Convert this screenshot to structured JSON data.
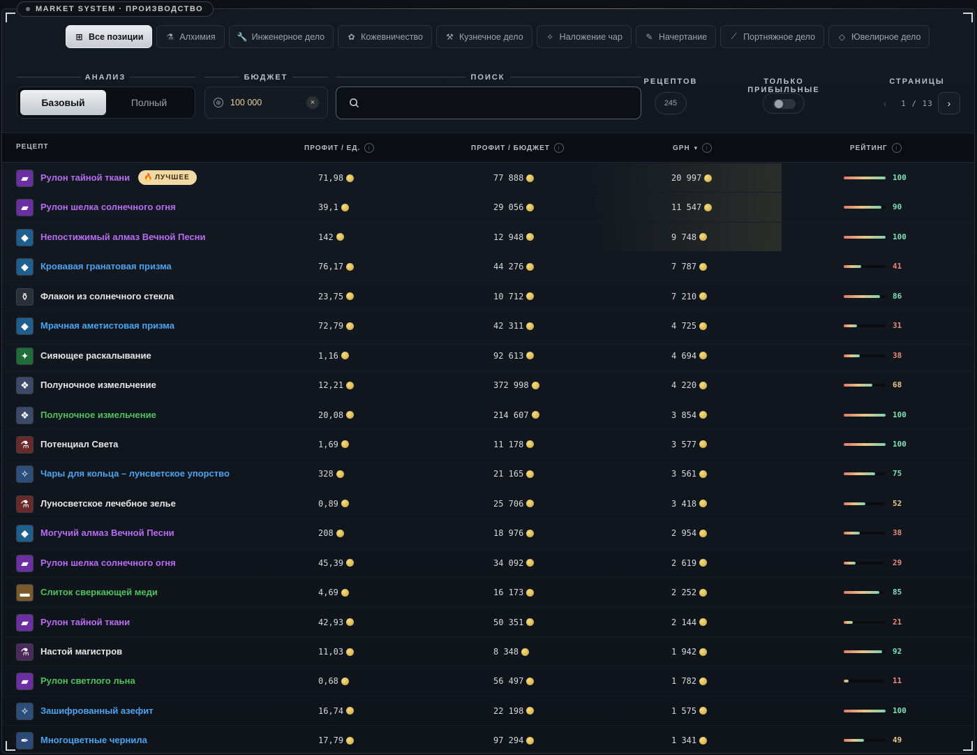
{
  "app": {
    "system_badge": "MARKET SYSTEM · ПРОИЗВОДСТВО"
  },
  "tabs": [
    {
      "label": "Все позиции",
      "icon": "grid-icon",
      "active": true
    },
    {
      "label": "Алхимия",
      "icon": "flask-icon"
    },
    {
      "label": "Инженерное дело",
      "icon": "wrench-icon"
    },
    {
      "label": "Кожевничество",
      "icon": "paw-icon"
    },
    {
      "label": "Кузнечное дело",
      "icon": "hammer-icon"
    },
    {
      "label": "Наложение чар",
      "icon": "sparkle-icon"
    },
    {
      "label": "Начертание",
      "icon": "pen-icon"
    },
    {
      "label": "Портняжное дело",
      "icon": "needle-icon"
    },
    {
      "label": "Ювелирное дело",
      "icon": "gem-icon"
    }
  ],
  "controls": {
    "analysis_label": "АНАЛИЗ",
    "analysis_options": [
      "Базовый",
      "Полный"
    ],
    "analysis_selected": "Базовый",
    "budget_label": "БЮДЖЕТ",
    "budget_value": "100 000",
    "budget_clear": "×",
    "search_label": "ПОИСК",
    "search_value": "",
    "recipes_label": "РЕЦЕПТОВ",
    "recipes_count": "245",
    "profitable_label": "ТОЛЬКО ПРИБЫЛЬНЫЕ",
    "profitable_on": false,
    "pages_label": "СТРАНИЦЫ",
    "page_current": "1",
    "page_sep": "/",
    "page_total": "13"
  },
  "table": {
    "headers": {
      "recipe": "РЕЦЕПТ",
      "profit_unit": "ПРОФИТ / ЕД.",
      "profit_budget": "ПРОФИТ / БЮДЖЕТ",
      "gph": "GPH",
      "gph_sort": "▾",
      "rating": "РЕЙТИНГ"
    },
    "best_badge": "ЛУЧШЕЕ",
    "rows": [
      {
        "name": "Рулон тайной ткани",
        "quality": "epic",
        "icon": "cloth-icon",
        "profit_unit": "71,98",
        "profit_budget": "77 888",
        "gph": "20 997",
        "rating": 100,
        "best": true
      },
      {
        "name": "Рулон шелка солнечного огня",
        "quality": "epic",
        "icon": "cloth-icon",
        "profit_unit": "39,1",
        "profit_budget": "29 056",
        "gph": "11 547",
        "rating": 90
      },
      {
        "name": "Непостижимый алмаз Вечной Песни",
        "quality": "epic",
        "icon": "gem-icon",
        "profit_unit": "142",
        "profit_budget": "12 948",
        "gph": "9 748",
        "rating": 100
      },
      {
        "name": "Кровавая гранатовая призма",
        "quality": "rare",
        "icon": "gem-icon",
        "profit_unit": "76,17",
        "profit_budget": "44 276",
        "gph": "7 787",
        "rating": 41
      },
      {
        "name": "Флакон из солнечного стекла",
        "quality": "common",
        "icon": "vial-icon",
        "profit_unit": "23,75",
        "profit_budget": "10 712",
        "gph": "7 210",
        "rating": 86
      },
      {
        "name": "Мрачная аметистовая призма",
        "quality": "rare",
        "icon": "gem-icon",
        "profit_unit": "72,79",
        "profit_budget": "42 311",
        "gph": "4 725",
        "rating": 31
      },
      {
        "name": "Сияющее раскалывание",
        "quality": "common",
        "icon": "shard-icon",
        "profit_unit": "1,16",
        "profit_budget": "92 613",
        "gph": "4 694",
        "rating": 38
      },
      {
        "name": "Полуночное измельчение",
        "quality": "common",
        "icon": "powder-icon",
        "profit_unit": "12,21",
        "profit_budget": "372 998",
        "gph": "4 220",
        "rating": 68
      },
      {
        "name": "Полуночное измельчение",
        "quality": "uncommon",
        "icon": "powder-icon",
        "profit_unit": "20,08",
        "profit_budget": "214 607",
        "gph": "3 854",
        "rating": 100
      },
      {
        "name": "Потенциал Света",
        "quality": "common",
        "icon": "potion-icon",
        "profit_unit": "1,69",
        "profit_budget": "11 178",
        "gph": "3 577",
        "rating": 100
      },
      {
        "name": "Чары для кольца – лунсветское упорство",
        "quality": "rare",
        "icon": "scroll-icon",
        "profit_unit": "328",
        "profit_budget": "21 165",
        "gph": "3 561",
        "rating": 75
      },
      {
        "name": "Луносветское лечебное зелье",
        "quality": "common",
        "icon": "potion-icon",
        "profit_unit": "0,89",
        "profit_budget": "25 706",
        "gph": "3 418",
        "rating": 52
      },
      {
        "name": "Могучий алмаз Вечной Песни",
        "quality": "epic",
        "icon": "gem-icon",
        "profit_unit": "208",
        "profit_budget": "18 976",
        "gph": "2 954",
        "rating": 38
      },
      {
        "name": "Рулон шелка солнечного огня",
        "quality": "epic",
        "icon": "cloth-icon",
        "profit_unit": "45,39",
        "profit_budget": "34 092",
        "gph": "2 619",
        "rating": 29
      },
      {
        "name": "Слиток сверкающей меди",
        "quality": "uncommon",
        "icon": "ingot-icon",
        "profit_unit": "4,69",
        "profit_budget": "16 173",
        "gph": "2 252",
        "rating": 85
      },
      {
        "name": "Рулон тайной ткани",
        "quality": "epic",
        "icon": "cloth-icon",
        "profit_unit": "42,93",
        "profit_budget": "50 351",
        "gph": "2 144",
        "rating": 21
      },
      {
        "name": "Настой магистров",
        "quality": "common",
        "icon": "flask-icon",
        "profit_unit": "11,03",
        "profit_budget": "8 348",
        "gph": "1 942",
        "rating": 92
      },
      {
        "name": "Рулон светлого льна",
        "quality": "uncommon",
        "icon": "cloth-icon",
        "profit_unit": "0,68",
        "profit_budget": "56 497",
        "gph": "1 782",
        "rating": 11
      },
      {
        "name": "Зашифрованный азефит",
        "quality": "rare",
        "icon": "scroll-icon",
        "profit_unit": "16,74",
        "profit_budget": "22 198",
        "gph": "1 575",
        "rating": 100
      },
      {
        "name": "Многоцветные чернила",
        "quality": "rare",
        "icon": "ink-icon",
        "profit_unit": "17,79",
        "profit_budget": "97 294",
        "gph": "1 341",
        "rating": 49
      }
    ]
  },
  "colors": {
    "epic": "#b86cf2",
    "rare": "#4aa3f0",
    "uncommon": "#4cc25a",
    "common": "#e6e6e6",
    "score_high": "#7fe0b5",
    "score_mid": "#e8c787",
    "score_low": "#e98a78"
  }
}
